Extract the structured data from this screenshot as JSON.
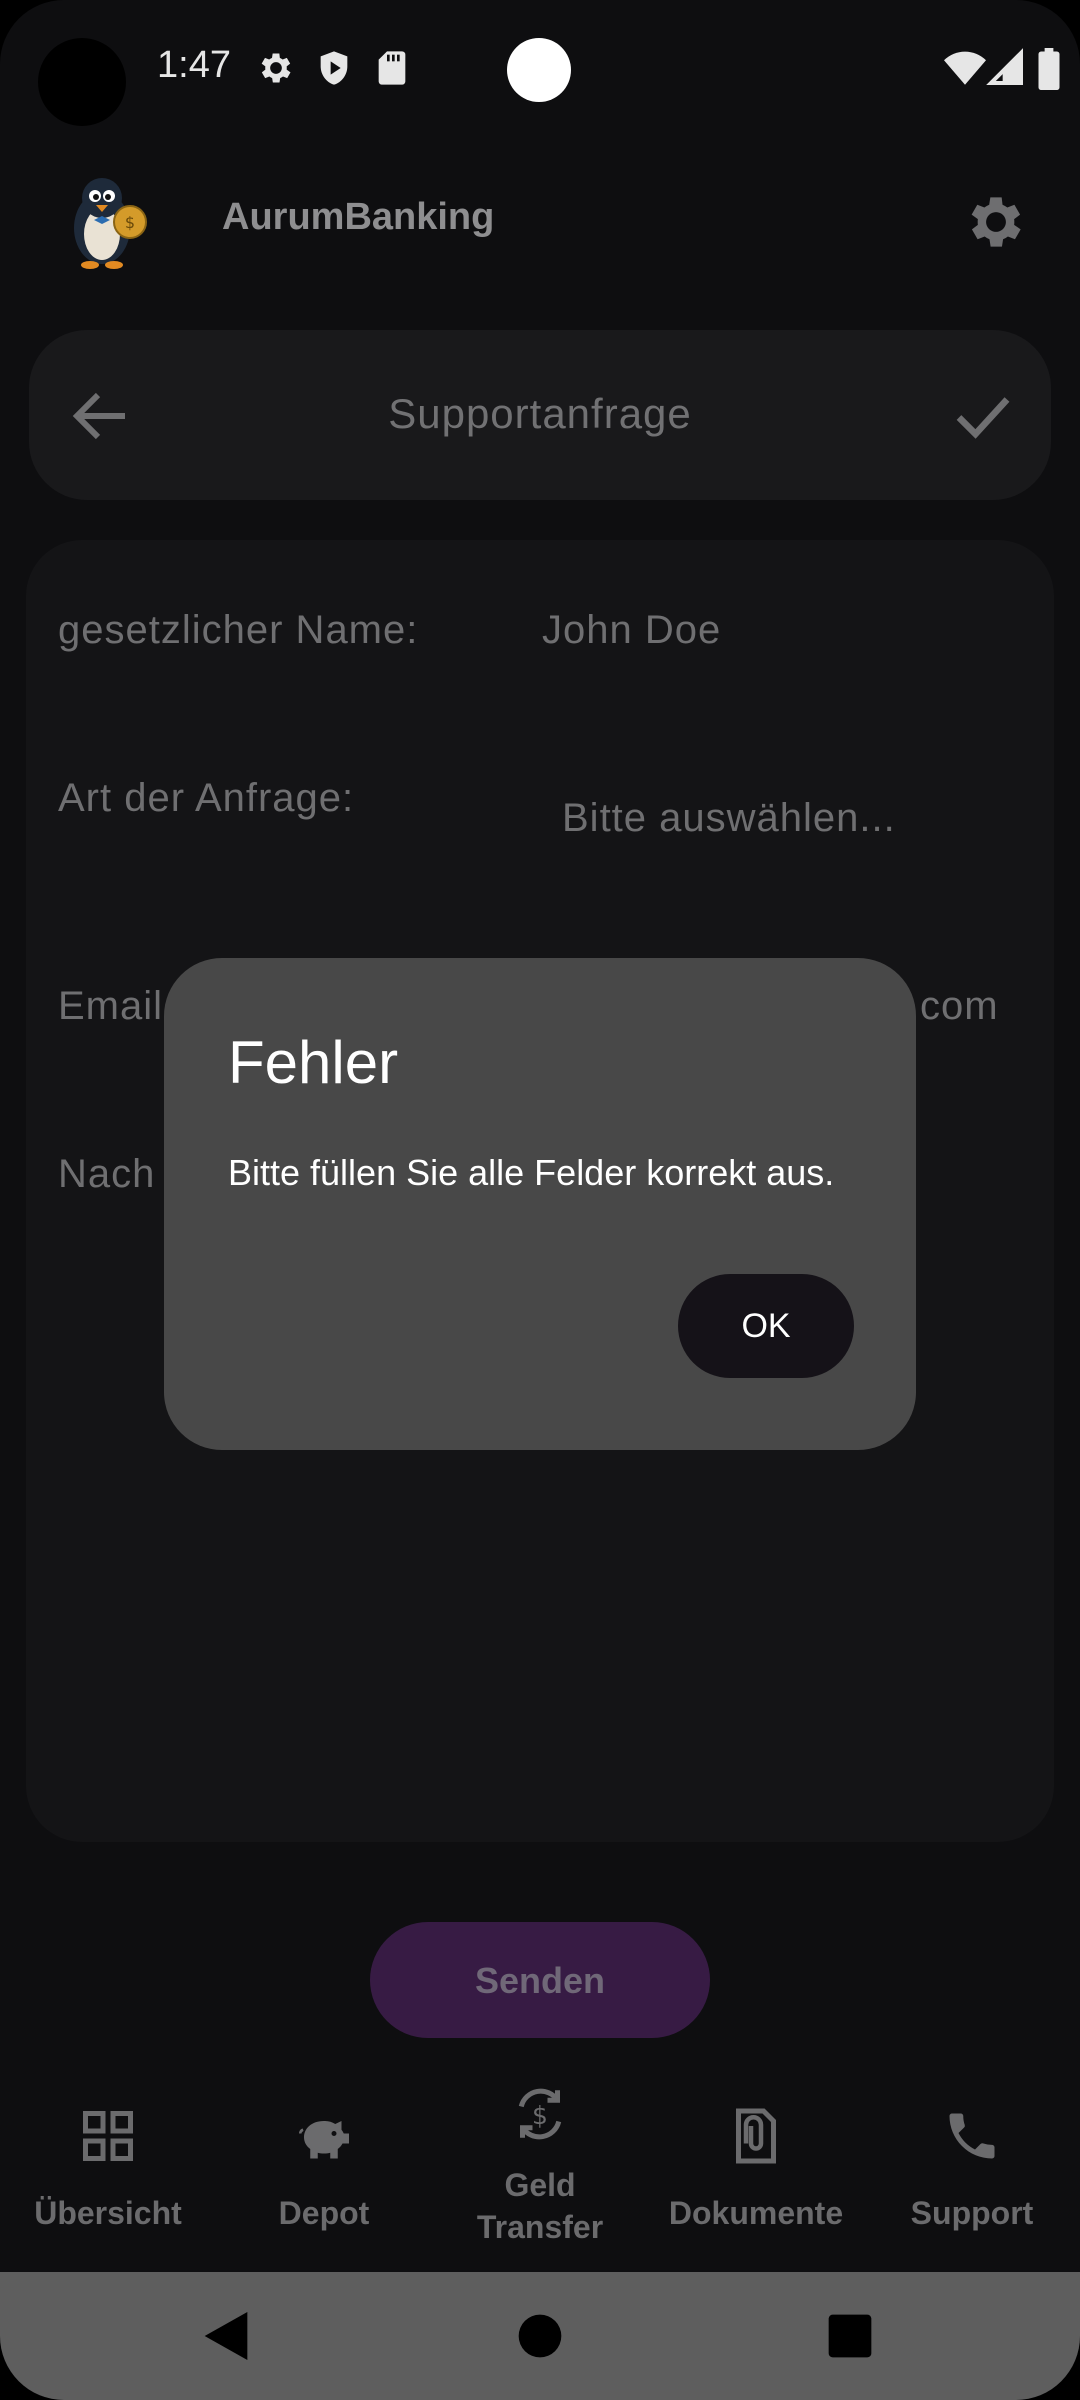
{
  "status_bar": {
    "time": "1:47",
    "icons": [
      "gear-icon",
      "shield-play-icon",
      "sd-card-icon",
      "wifi-icon",
      "signal-icon",
      "battery-icon"
    ]
  },
  "app_bar": {
    "title": "AurumBanking",
    "logo": "penguin-logo",
    "settings_icon": "gear-icon"
  },
  "toolbar": {
    "title": "Supportanfrage",
    "back_icon": "arrow-left-icon",
    "confirm_icon": "check-icon"
  },
  "form": {
    "name_label": "gesetzlicher Name:",
    "name_value": "John Doe",
    "type_label": "Art der Anfrage:",
    "type_value": "Bitte auswählen...",
    "email_label": "Email",
    "email_value": "com",
    "message_label": "Nach"
  },
  "send_button": {
    "label": "Senden"
  },
  "bottom_nav": {
    "items": [
      {
        "label": "Übersicht",
        "icon": "grid-icon"
      },
      {
        "label": "Depot",
        "icon": "piggy-bank-icon"
      },
      {
        "label_line1": "Geld",
        "label_line2": "Transfer",
        "icon": "currency-exchange-icon"
      },
      {
        "label": "Dokumente",
        "icon": "attachment-icon"
      },
      {
        "label": "Support",
        "icon": "phone-icon"
      }
    ]
  },
  "dialog": {
    "title": "Fehler",
    "message": "Bitte füllen Sie alle Felder korrekt aus.",
    "ok_label": "OK"
  },
  "colors": {
    "background": "#0e0e10",
    "dialog": "#484848",
    "send_button": "#371b44",
    "system_nav": "#5e5e5e"
  }
}
